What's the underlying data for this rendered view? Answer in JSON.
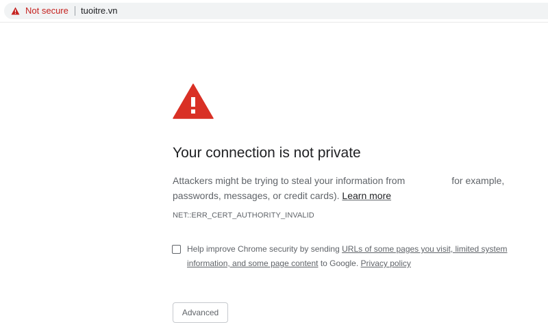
{
  "address_bar": {
    "security_icon": "warning-triangle-icon",
    "security_label": "Not secure",
    "url": "tuoitre.vn"
  },
  "interstitial": {
    "icon": "warning-triangle-icon",
    "heading": "Your connection is not private",
    "body_part1": "Attackers might be trying to steal your information from",
    "body_part2": "for example, passwords, messages, or credit cards).",
    "learn_more": "Learn more",
    "error_code": "NET::ERR_CERT_AUTHORITY_INVALID",
    "help_prefix": "Help improve Chrome security by sending",
    "help_link": "URLs of some pages you visit, limited system information, and some page content",
    "help_middle": "to Google.",
    "privacy_link": "Privacy policy",
    "advanced_label": "Advanced"
  },
  "colors": {
    "warning_red": "#d93025",
    "not_secure_text": "#c5221f"
  }
}
